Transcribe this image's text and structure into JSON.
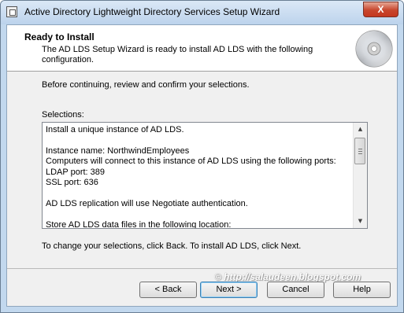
{
  "window": {
    "title": "Active Directory Lightweight Directory Services Setup Wizard",
    "close_glyph": "X"
  },
  "header": {
    "title": "Ready to Install",
    "description": "The AD LDS Setup Wizard is ready to install AD LDS with the following configuration."
  },
  "main": {
    "intro": "Before continuing, review and confirm your selections.",
    "selections_label": "Selections:",
    "selections_lines": [
      "Install a unique instance of AD LDS.",
      "",
      "Instance name: NorthwindEmployees",
      "Computers will connect to this instance of AD LDS using the following ports:",
      "LDAP port: 389",
      "SSL port: 636",
      "",
      "AD LDS replication will use Negotiate authentication.",
      "",
      "Store AD LDS data files in the following location:"
    ],
    "hint": "To change your selections, click Back.  To install AD LDS, click Next."
  },
  "watermark": "© http://salaudeen.blogspot.com",
  "buttons": {
    "back": "< Back",
    "next": "Next >",
    "cancel": "Cancel",
    "help": "Help"
  },
  "icons": {
    "app": "window-app-icon",
    "header": "cd-disc-icon"
  }
}
